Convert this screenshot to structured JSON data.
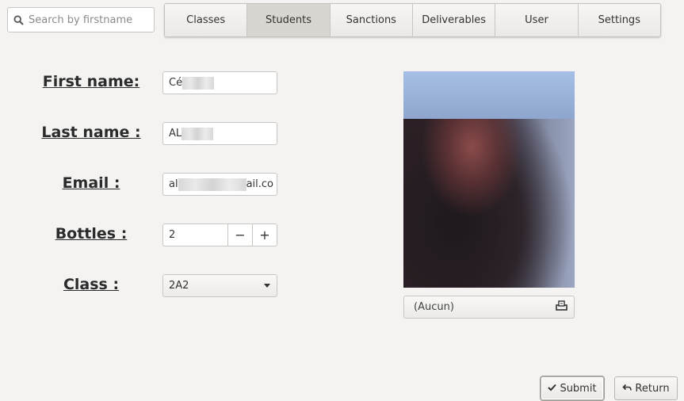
{
  "search": {
    "placeholder": "Search by firstname",
    "icon": "search-icon"
  },
  "tabs": [
    {
      "label": "Classes",
      "active": false
    },
    {
      "label": "Students",
      "active": true
    },
    {
      "label": "Sanctions",
      "active": false
    },
    {
      "label": "Deliverables",
      "active": false
    },
    {
      "label": "User",
      "active": false
    },
    {
      "label": "Settings",
      "active": false
    }
  ],
  "form": {
    "first_name": {
      "label": "First name:",
      "value": "Cé"
    },
    "last_name": {
      "label": "Last name :",
      "value": "AL"
    },
    "email": {
      "label": "Email :",
      "value_start": "al",
      "value_end": "ail.co"
    },
    "bottles": {
      "label": "Bottles :",
      "value": "2",
      "decrement": "−",
      "increment": "+"
    },
    "class": {
      "label": "Class :",
      "value": "2A2"
    }
  },
  "photo": {
    "file_label": "(Aucun)",
    "file_icon": "upload-icon"
  },
  "actions": {
    "submit": "Submit",
    "return": "Return"
  }
}
